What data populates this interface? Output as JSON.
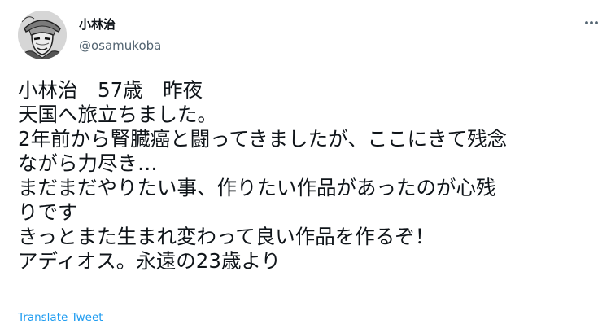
{
  "author": {
    "display_name": "小林治",
    "handle": "@osamukoba"
  },
  "tweet": {
    "lines": [
      "小林治　57歳　昨夜",
      "天国へ旅立ちました。",
      "2年前から腎臓癌と闘ってきましたが、ここにきて残念",
      "ながら力尽き…",
      "まだまだやりたい事、作りたい作品があったのが心残",
      "りです",
      "きっとまた生まれ変わって良い作品を作るぞ！",
      "アディオス。永遠の23歳より"
    ]
  },
  "actions": {
    "translate_label": "Translate Tweet",
    "more_icon": "ellipsis-icon"
  },
  "colors": {
    "text": "#0f1419",
    "secondary": "#536471",
    "link": "#1d9bf0"
  }
}
